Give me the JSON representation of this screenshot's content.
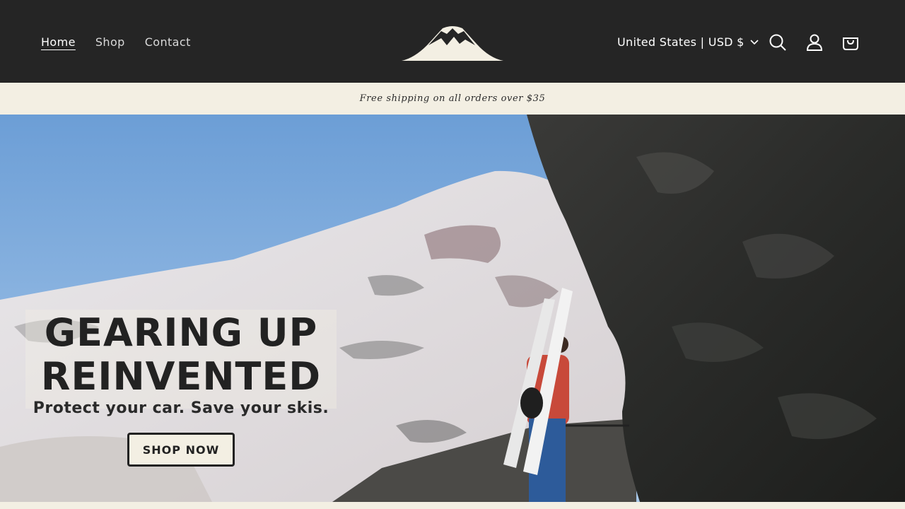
{
  "header": {
    "nav": [
      {
        "label": "Home",
        "active": true
      },
      {
        "label": "Shop",
        "active": false
      },
      {
        "label": "Contact",
        "active": false
      }
    ],
    "logo_icon": "mountain-logo",
    "currency_selector": "United States | USD $",
    "icons": [
      "search-icon",
      "account-icon",
      "cart-icon"
    ]
  },
  "announcement": {
    "text": "Free shipping on all orders over $35"
  },
  "hero": {
    "title_line1": "GEARING UP",
    "title_line2": "REINVENTED",
    "subtitle": "Protect your car. Save your skis.",
    "button_label": "SHOP NOW",
    "image_icon": "mountain-skier-photo"
  },
  "colors": {
    "header_bg": "#252525",
    "cream": "#f3efe3",
    "text_dark": "#222222"
  }
}
